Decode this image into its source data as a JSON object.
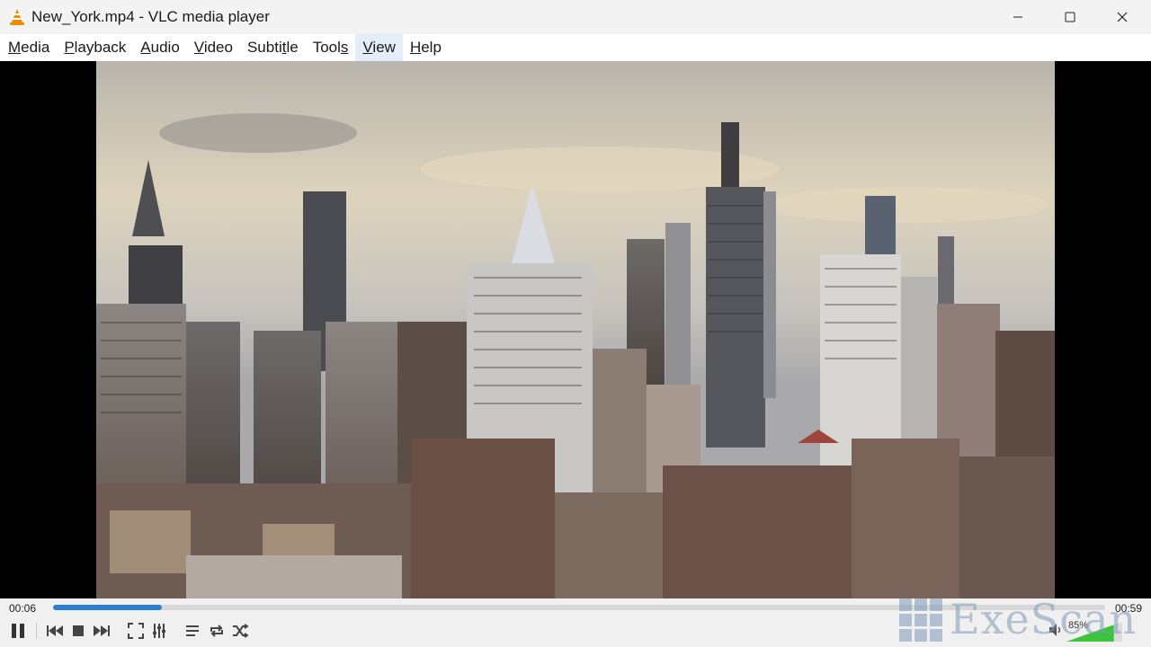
{
  "window": {
    "title": "New_York.mp4 - VLC media player"
  },
  "menu": {
    "items": [
      {
        "label_u": "M",
        "label_rest": "edia"
      },
      {
        "label_u": "P",
        "label_rest": "layback"
      },
      {
        "label_u": "A",
        "label_rest": "udio"
      },
      {
        "label_u": "V",
        "label_rest": "ideo"
      },
      {
        "label_pre": "Subti",
        "label_u": "t",
        "label_rest": "le"
      },
      {
        "label_pre": "Tool",
        "label_u": "s",
        "label_rest": ""
      },
      {
        "label_u": "V",
        "label_rest": "iew",
        "hover": true
      },
      {
        "label_u": "H",
        "label_rest": "elp"
      }
    ]
  },
  "player": {
    "elapsed": "00:06",
    "total": "00:59",
    "progress": 0.103,
    "volume_label": "85%",
    "volume_level": 0.85
  },
  "icons": {
    "app": "vlc-cone-icon",
    "minimize": "minimize-icon",
    "maximize": "maximize-icon",
    "close": "close-icon",
    "pause": "pause-icon",
    "previous": "previous-icon",
    "stop": "stop-icon",
    "next": "next-icon",
    "fullscreen": "fullscreen-icon",
    "extended": "extended-settings-icon",
    "playlist": "playlist-icon",
    "loop": "loop-icon",
    "shuffle": "shuffle-icon",
    "volume": "volume-icon"
  },
  "colors": {
    "accent": "#2a7fd2",
    "volume_fill": "#3cc43c",
    "vlc_orange": "#f08a00"
  },
  "watermark": {
    "text": "ExeScan"
  }
}
